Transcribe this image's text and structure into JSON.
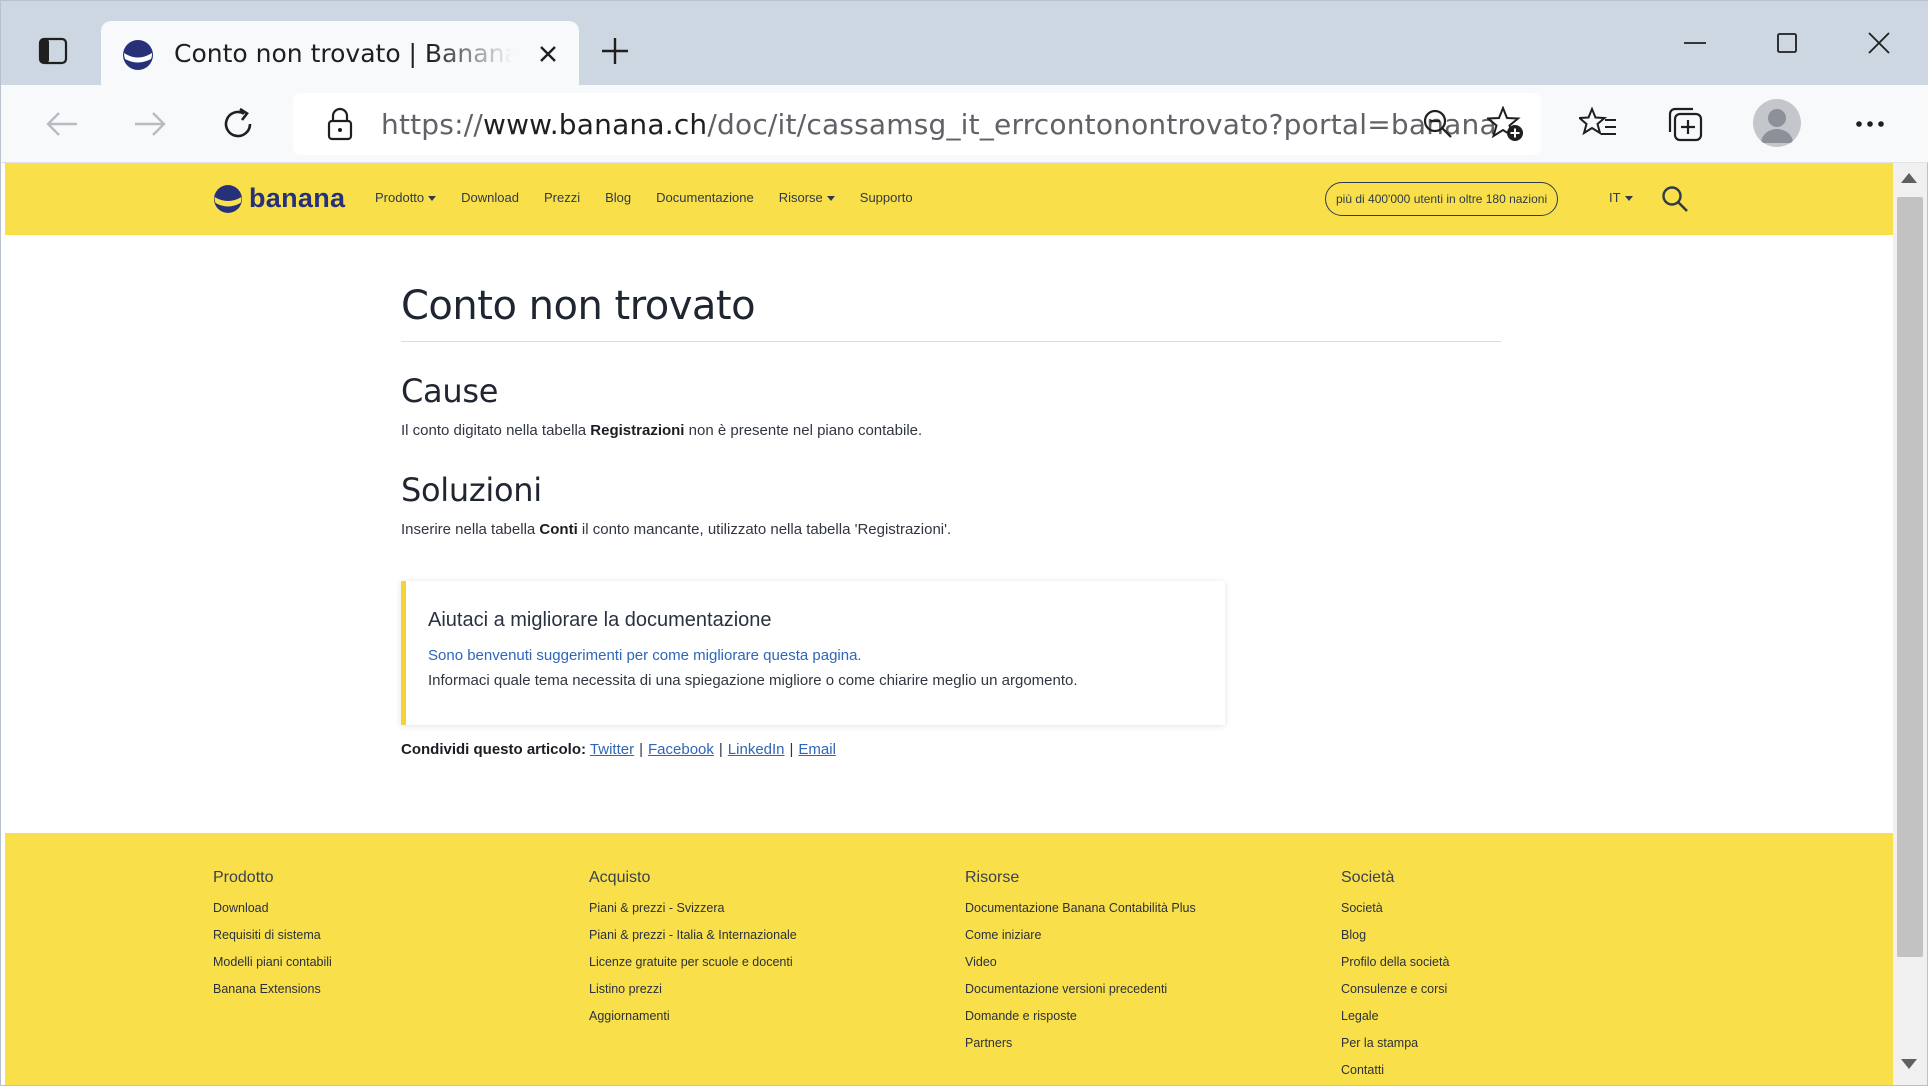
{
  "browser": {
    "tab": {
      "title": "Conto non trovato | Banana Contabilità"
    },
    "address": {
      "scheme": "https://",
      "host": "www.banana.ch",
      "path": "/doc/it/cassamsg_it_errcontonontrovato?portal=banana"
    },
    "icons": [
      "tab-actions-icon",
      "close-icon",
      "plus-icon",
      "minimize-icon",
      "maximize-icon",
      "close-window-icon",
      "back-arrow-icon",
      "forward-arrow-icon",
      "refresh-icon",
      "lock-icon",
      "zoom-out-icon",
      "add-favorite-icon",
      "favorites-icon",
      "collections-icon",
      "profile-icon",
      "more-icon"
    ]
  },
  "site": {
    "logo": "banana",
    "nav": [
      {
        "label": "Prodotto",
        "dropdown": true
      },
      {
        "label": "Download",
        "dropdown": false
      },
      {
        "label": "Prezzi",
        "dropdown": false
      },
      {
        "label": "Blog",
        "dropdown": false
      },
      {
        "label": "Documentazione",
        "dropdown": false
      },
      {
        "label": "Risorse",
        "dropdown": true
      },
      {
        "label": "Supporto",
        "dropdown": false
      }
    ],
    "users_pill": "più di 400'000 utenti in oltre 180 nazioni",
    "language": "IT",
    "brand_yellow": "#f9e04b",
    "brand_blue": "#26317a"
  },
  "content": {
    "title": "Conto non trovato",
    "cause_heading": "Cause",
    "cause_text_before": "Il conto digitato nella tabella ",
    "cause_text_bold": "Registrazioni",
    "cause_text_after": " non è presente nel piano contabile.",
    "solutions_heading": "Soluzioni",
    "solutions_text_before": "Inserire nella tabella ",
    "solutions_text_bold": "Conti",
    "solutions_text_after": " il conto mancante, utilizzato nella tabella 'Registrazioni'.",
    "help_box": {
      "title": "Aiutaci a migliorare la documentazione",
      "link": "Sono benvenuti suggerimenti per come migliorare questa pagina.",
      "text": "Informaci quale tema necessita di una spiegazione migliore o come chiarire meglio un argomento."
    },
    "share": {
      "label": "Condividi questo articolo:",
      "links": [
        "Twitter",
        "Facebook",
        "LinkedIn",
        "Email"
      ]
    }
  },
  "footer": {
    "columns": [
      {
        "title": "Prodotto",
        "items": [
          "Download",
          "Requisiti di sistema",
          "Modelli piani contabili",
          "Banana Extensions"
        ]
      },
      {
        "title": "Acquisto",
        "items": [
          "Piani & prezzi - Svizzera",
          "Piani & prezzi - Italia & Internazionale",
          "Licenze gratuite per scuole e docenti",
          "Listino prezzi",
          "Aggiornamenti"
        ]
      },
      {
        "title": "Risorse",
        "items": [
          "Documentazione Banana Contabilità Plus",
          "Come iniziare",
          "Video",
          "Documentazione versioni precedenti",
          "Domande e risposte",
          "Partners"
        ]
      },
      {
        "title": "Società",
        "items": [
          "Società",
          "Blog",
          "Profilo della società",
          "Consulenze e corsi",
          "Legale",
          "Per la stampa",
          "Contatti"
        ]
      }
    ]
  }
}
